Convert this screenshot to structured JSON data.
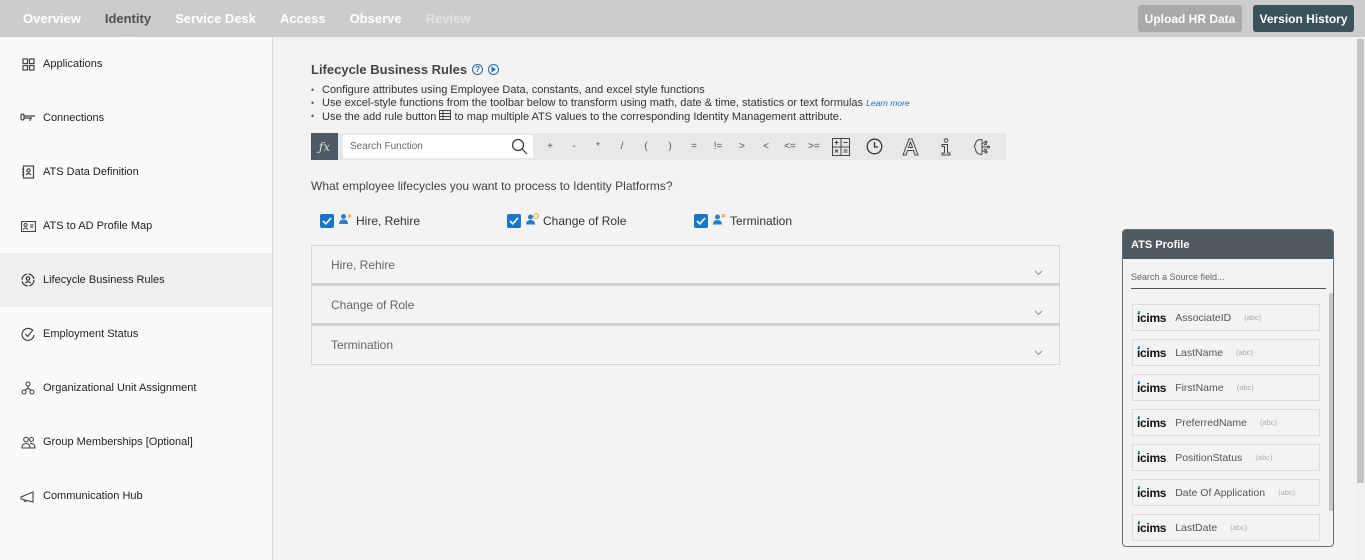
{
  "topnav": {
    "items": [
      {
        "label": "Overview",
        "state": "normal"
      },
      {
        "label": "Identity",
        "state": "active"
      },
      {
        "label": "Service Desk",
        "state": "normal"
      },
      {
        "label": "Access",
        "state": "normal"
      },
      {
        "label": "Observe",
        "state": "normal"
      },
      {
        "label": "Review",
        "state": "disabled"
      }
    ],
    "upload_label": "Upload HR Data",
    "version_label": "Version History"
  },
  "sidebar": {
    "active_index": 4,
    "items": [
      {
        "label": "Applications",
        "icon": "grid-icon"
      },
      {
        "label": "Connections",
        "icon": "connection-icon"
      },
      {
        "label": "ATS Data Definition",
        "icon": "contact-book-icon"
      },
      {
        "label": "ATS to AD Profile Map",
        "icon": "id-card-icon"
      },
      {
        "label": "Lifecycle Business Rules",
        "icon": "user-cycle-icon"
      },
      {
        "label": "Employment Status",
        "icon": "check-circle-icon"
      },
      {
        "label": "Organizational Unit Assignment",
        "icon": "org-chart-icon"
      },
      {
        "label": "Group Memberships [Optional]",
        "icon": "group-icon"
      },
      {
        "label": "Communication Hub",
        "icon": "megaphone-icon"
      }
    ]
  },
  "main": {
    "title": "Lifecycle Business Rules",
    "help_icon": "?",
    "bullets": {
      "b1": "Configure attributes using Employee Data, constants, and excel style functions",
      "b2": "Use excel-style functions from the toolbar below to transform using math, date & time, statistics or text formulas",
      "b2_link": "Learn more",
      "b3_pre": "Use the add rule button",
      "b3_post": "to map multiple ATS values to the corresponding Identity Management attribute."
    },
    "toolbar": {
      "fx_label": "ƒx",
      "search_placeholder": "Search Function",
      "operators": [
        "+",
        "-",
        "*",
        "/",
        "(",
        ")",
        "=",
        "!=",
        ">",
        "<",
        "<=",
        ">="
      ],
      "tools": [
        "math-calculator-icon",
        "clock-icon",
        "text-format-icon",
        "info-icon",
        "ai-brain-icon"
      ]
    },
    "question": "What employee lifecycles you want to process to Identity Platforms?",
    "lifecycles": [
      {
        "label": "Hire, Rehire",
        "checked": true,
        "icon": "user-add-icon"
      },
      {
        "label": "Change of Role",
        "checked": true,
        "icon": "user-change-icon"
      },
      {
        "label": "Termination",
        "checked": true,
        "icon": "user-remove-icon"
      }
    ],
    "accordion": [
      {
        "label": "Hire, Rehire"
      },
      {
        "label": "Change of Role"
      },
      {
        "label": "Termination"
      }
    ]
  },
  "ats_profile": {
    "title": "ATS Profile",
    "search_placeholder": "Search a Source field...",
    "source_logo": "icims",
    "fields": [
      {
        "name": "AssociateID",
        "type": "(abc)"
      },
      {
        "name": "LastName",
        "type": "(abc)"
      },
      {
        "name": "FirstName",
        "type": "(abc)"
      },
      {
        "name": "PreferredName",
        "type": "(abc)"
      },
      {
        "name": "PositionStatus",
        "type": "(abc)"
      },
      {
        "name": "Date Of Application",
        "type": "(abc)"
      },
      {
        "name": "LastDate",
        "type": "(abc)"
      }
    ]
  },
  "colors": {
    "accent_blue": "#1877c9",
    "dark_button": "#3a5259",
    "panel_header": "#4f5a62",
    "icims_dot": "#17a3b8",
    "user_icon_orange": "#f2a93b"
  }
}
